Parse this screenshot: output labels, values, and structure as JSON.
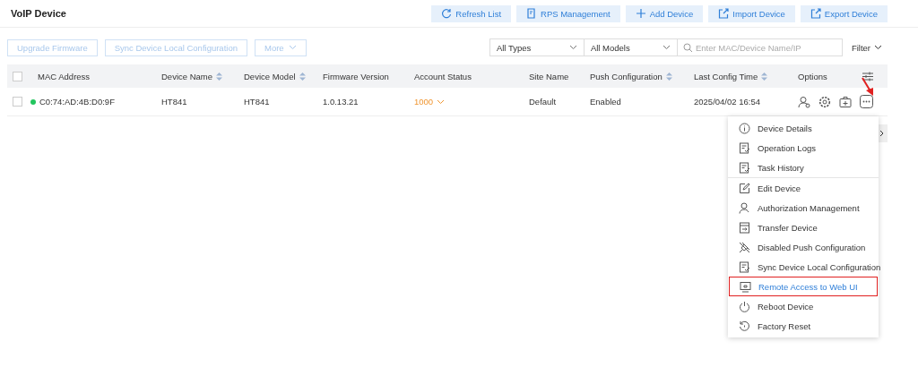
{
  "title": "VoIP Device",
  "header_buttons": [
    {
      "label": "Refresh List"
    },
    {
      "label": "RPS Management"
    },
    {
      "label": "Add Device"
    },
    {
      "label": "Import Device"
    },
    {
      "label": "Export Device"
    }
  ],
  "actions": [
    {
      "label": "Upgrade Firmware",
      "disabled": true
    },
    {
      "label": "Sync Device Local Configuration",
      "disabled": true
    },
    {
      "label": "More",
      "disabled": true
    }
  ],
  "type_select": "All Types",
  "model_select": "All Models",
  "search": {
    "placeholder": "Enter MAC/Device Name/IP"
  },
  "filter": "Filter",
  "all_checked": false,
  "columns": [
    {
      "label": "MAC Address",
      "sortable": false
    },
    {
      "label": "Device Name",
      "sortable": true
    },
    {
      "label": "Device Model",
      "sortable": true
    },
    {
      "label": "Firmware Version",
      "sortable": false
    },
    {
      "label": "Account Status",
      "sortable": false
    },
    {
      "label": "Site Name",
      "sortable": false
    },
    {
      "label": "Push Configuration",
      "sortable": true
    },
    {
      "label": "Last Config Time",
      "sortable": true
    },
    {
      "label": "Options",
      "sortable": false
    }
  ],
  "rows": [
    {
      "checked": false,
      "online": true,
      "mac": "C0:74:AD:4B:D0:9F",
      "name": "HT841",
      "model": "HT841",
      "firmware": "1.0.13.21",
      "account": "1000",
      "site": "Default",
      "push": "Enabled",
      "time": "2025/04/02 16:54"
    }
  ],
  "menu": [
    {
      "label": "Device Details",
      "highlighted": false,
      "divider_before": false
    },
    {
      "label": "Operation Logs",
      "highlighted": false,
      "divider_before": false
    },
    {
      "label": "Task History",
      "highlighted": false,
      "divider_before": false
    },
    {
      "label": "Edit Device",
      "highlighted": false,
      "divider_before": true
    },
    {
      "label": "Authorization Management",
      "highlighted": false,
      "divider_before": false
    },
    {
      "label": "Transfer Device",
      "highlighted": false,
      "divider_before": false
    },
    {
      "label": "Disabled Push Configuration",
      "highlighted": false,
      "divider_before": false
    },
    {
      "label": "Sync Device Local Configuration",
      "highlighted": false,
      "divider_before": false
    },
    {
      "label": "Remote Access to Web UI",
      "highlighted": true,
      "divider_before": false
    },
    {
      "label": "Reboot Device",
      "highlighted": false,
      "divider_before": false
    },
    {
      "label": "Factory Reset",
      "highlighted": false,
      "divider_before": false
    }
  ]
}
